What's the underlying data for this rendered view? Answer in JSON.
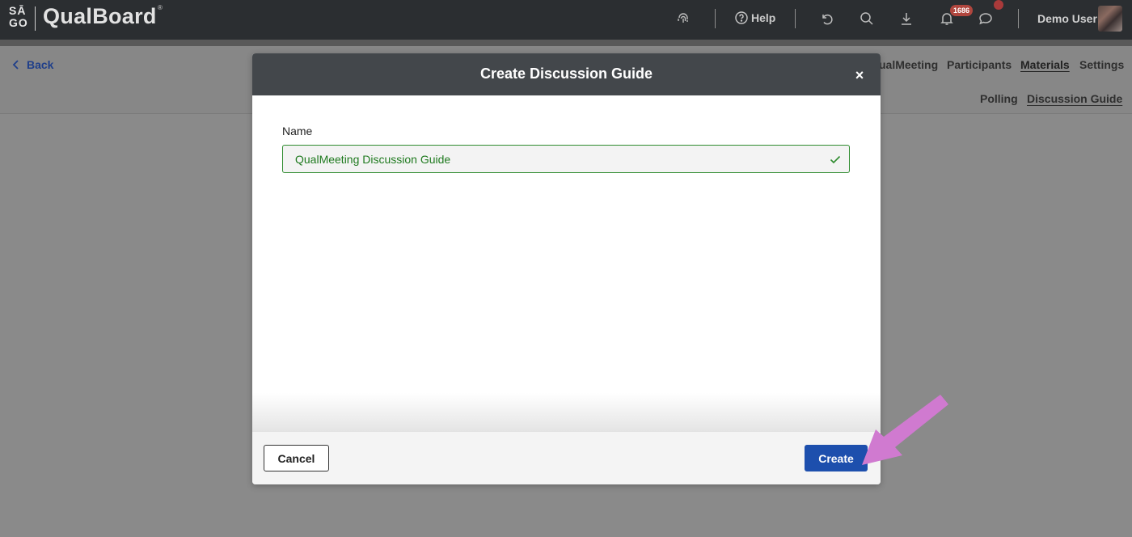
{
  "app": {
    "logo_mark_top": "SĀ",
    "logo_mark_bottom": "GO",
    "name": "QualBoard",
    "reg": "®"
  },
  "topbar": {
    "help_label": "Help",
    "notification_count": "1686",
    "user_name": "Demo User",
    "icons": [
      "fingerprint-icon",
      "help-circle-icon",
      "undo-icon",
      "search-icon",
      "download-icon",
      "bell-icon",
      "chat-icon"
    ]
  },
  "nav": {
    "back_label": "Back",
    "tabs": [
      "ualMeeting",
      "Participants",
      "Materials",
      "Settings"
    ],
    "active_tab": "Materials",
    "subtabs": [
      "Polling",
      "Discussion Guide"
    ],
    "active_subtab": "Discussion Guide"
  },
  "modal": {
    "title": "Create Discussion Guide",
    "close_label": "×",
    "name_label": "Name",
    "name_value": "QualMeeting Discussion Guide",
    "cancel_label": "Cancel",
    "create_label": "Create"
  },
  "colors": {
    "topbar": "#2b2e31",
    "modal_header": "#43474b",
    "primary": "#1d4fad",
    "valid_green": "#2e8b2e",
    "arrow": "#d07ad0"
  }
}
